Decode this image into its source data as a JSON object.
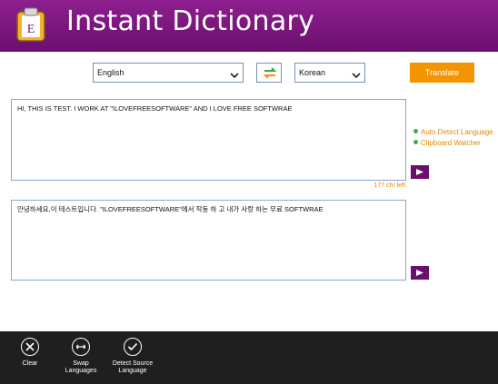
{
  "header": {
    "title": "Instant Dictionary",
    "logo_letter": "E",
    "background": "#7a137c"
  },
  "controls": {
    "source_language": "English",
    "target_language": "Korean",
    "translate_label": "Translate",
    "accent": "#f49400"
  },
  "input": {
    "text": "HI, THIS IS TEST. I WORK AT \"ILOVEFREESOFTWARE\" AND I LOVE FREE SOFTWRAE",
    "chars_left": "177 chr left."
  },
  "output": {
    "text": "안녕하세요,이 테스트입니다. \"ILOVEFREESOFTWARE\"에서 작동 하 고 내가 사랑 하는 무료 SOFTWRAE"
  },
  "options": {
    "auto_detect": "Auto Detect Language",
    "clipboard_watcher": "Clipboard Watcher"
  },
  "appbar": {
    "clear": "Clear",
    "swap_line1": "Swap",
    "swap_line2": "Languages",
    "detect_line1": "Detect Source",
    "detect_line2": "Language"
  },
  "icons": [
    "app-logo-icon",
    "chevron-down-icon",
    "swap-arrows-icon",
    "play-icon",
    "close-icon",
    "swap-icon",
    "check-icon"
  ]
}
